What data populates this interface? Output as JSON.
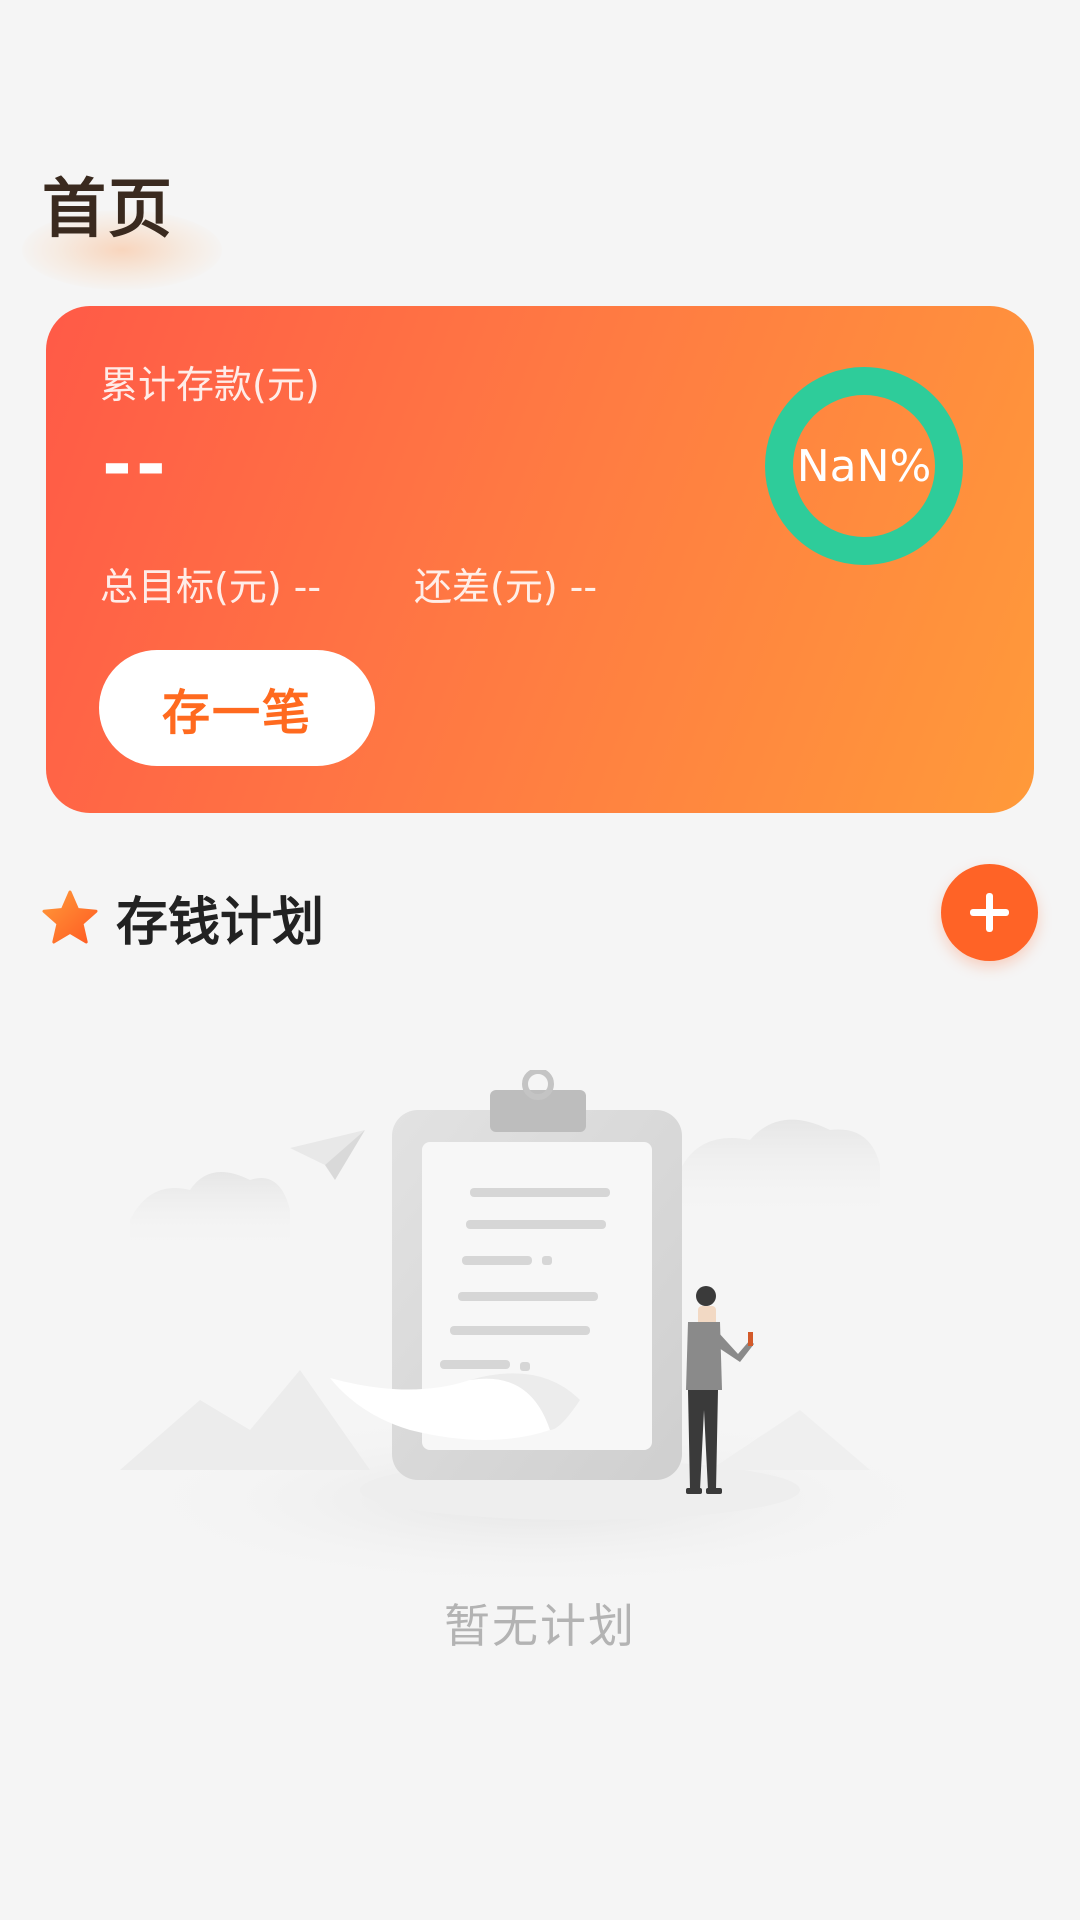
{
  "page": {
    "title": "首页"
  },
  "summary": {
    "total_label": "累计存款(元)",
    "total_value": "--",
    "goal_label": "总目标(元)",
    "goal_value": "--",
    "diff_label": "还差(元)",
    "diff_value": "--",
    "progress_text": "NaN%",
    "save_button_label": "存一笔",
    "colors": {
      "gradient_start": "#ff5a47",
      "gradient_end": "#ff9a3a",
      "ring": "#2ecc9a"
    }
  },
  "plans": {
    "title": "存钱计划",
    "icon": "star-icon",
    "add_icon": "plus-icon",
    "empty_text": "暂无计划",
    "empty_icon": "clipboard-empty-illustration"
  },
  "colors": {
    "accent": "#ff6326",
    "background": "#f5f5f5"
  }
}
